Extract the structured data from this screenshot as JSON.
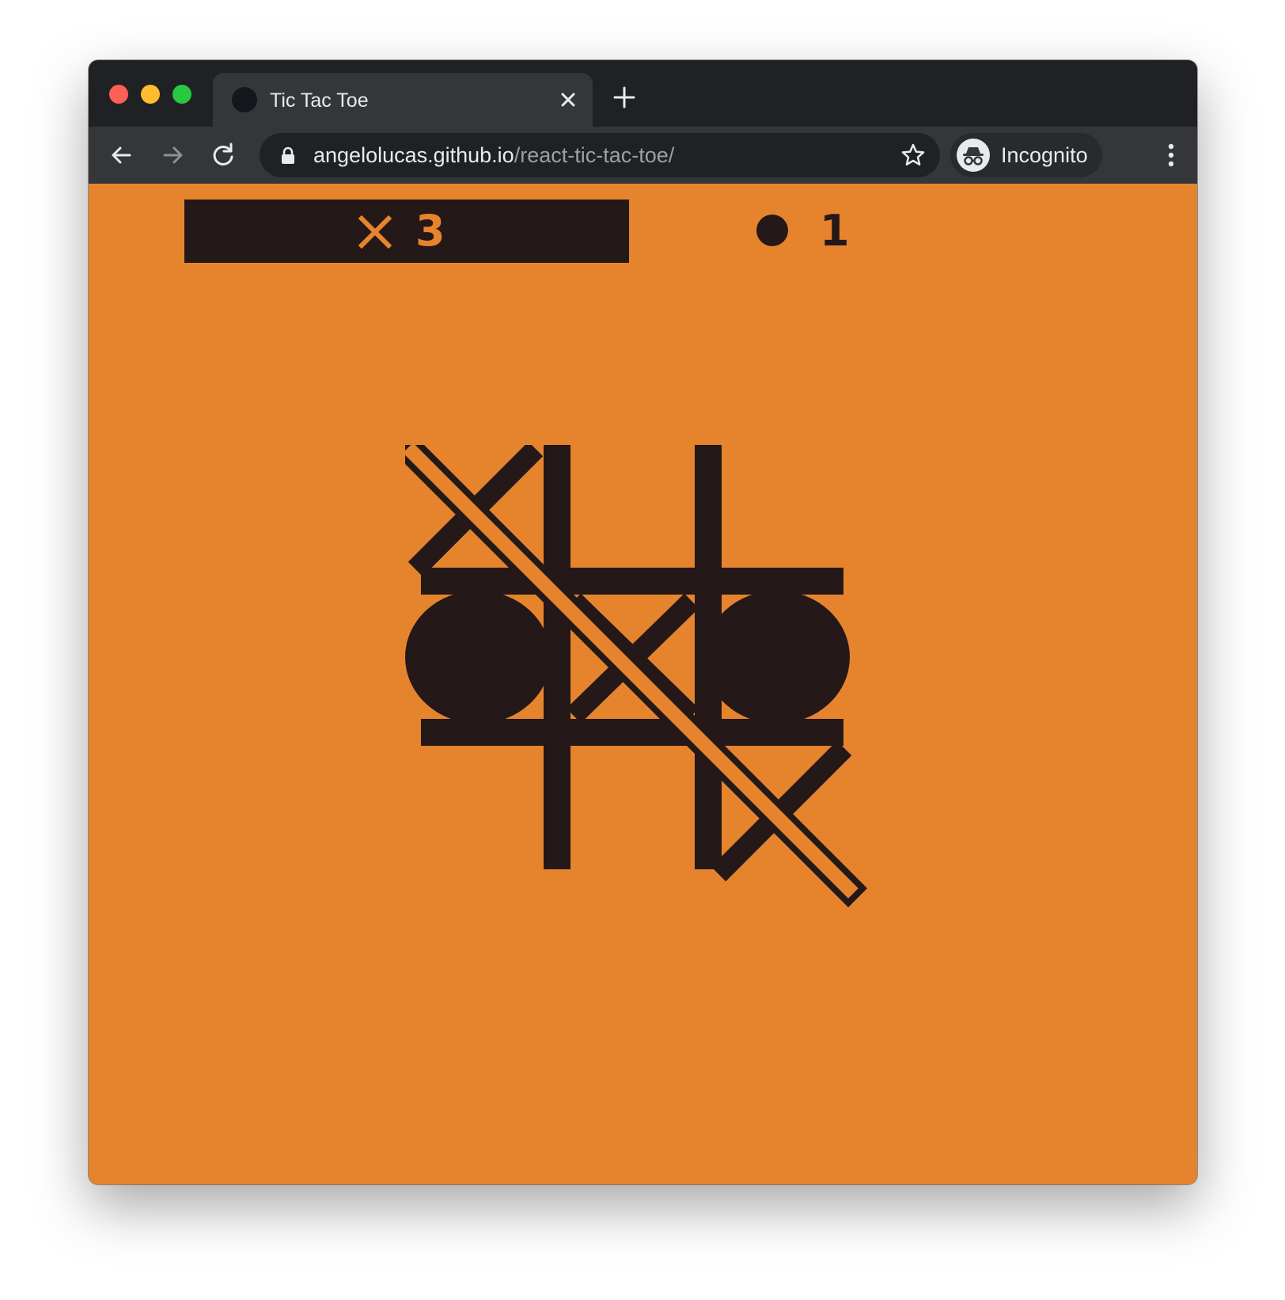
{
  "browser": {
    "tab_title": "Tic Tac Toe",
    "tab_close_icon": "close-icon",
    "new_tab_icon": "plus-icon",
    "url_host": "angelolucas.github.io",
    "url_path": "/react-tic-tac-toe/",
    "profile_label": "Incognito",
    "icons": [
      "back-arrow-icon",
      "forward-arrow-icon",
      "reload-icon",
      "lock-icon",
      "star-icon",
      "incognito-icon",
      "kebab-menu-icon"
    ]
  },
  "game": {
    "score_x": {
      "symbol": "X",
      "value": "3"
    },
    "score_o": {
      "symbol": "O",
      "value": "1"
    },
    "board": [
      "X",
      "",
      "",
      "O",
      "X",
      "O",
      "",
      "",
      "X"
    ],
    "winning_line": "diagonal top-left to bottom-right",
    "colors": {
      "background": "#e6842d",
      "ink": "#241818"
    }
  }
}
